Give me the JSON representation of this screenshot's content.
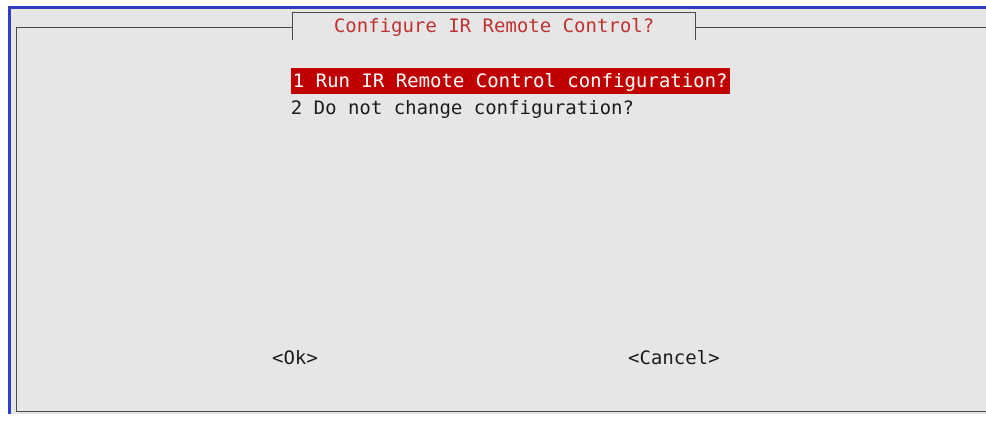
{
  "dialog": {
    "title": "Configure IR Remote Control?",
    "colors": {
      "background": "#e6e6e6",
      "title_text": "#c03030",
      "highlight_bg": "#c00000",
      "highlight_text": "#ffffff",
      "outer_border": "#2f3fc8"
    }
  },
  "menu": {
    "items": [
      {
        "label": "1 Run IR Remote Control configuration?",
        "selected": true
      },
      {
        "label": "2 Do not change configuration?",
        "selected": false
      }
    ]
  },
  "buttons": {
    "ok_label": "<Ok>",
    "cancel_label": "<Cancel>"
  }
}
